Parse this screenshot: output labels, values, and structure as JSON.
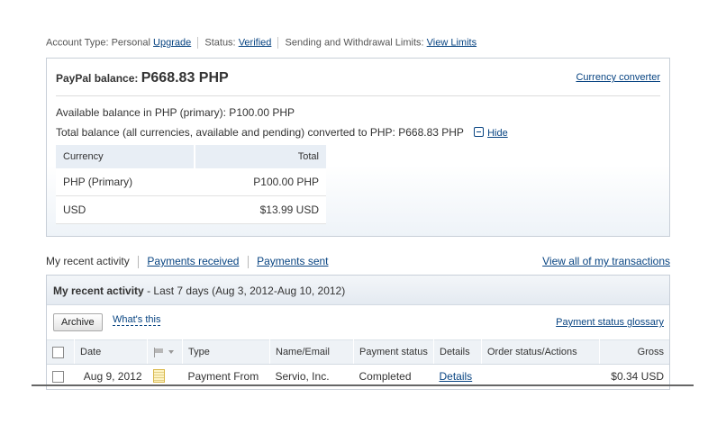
{
  "account_bar": {
    "account_type_label": "Account Type: Personal",
    "upgrade_link": "Upgrade",
    "status_label": "Status:",
    "status_link": "Verified",
    "limits_label": "Sending and Withdrawal Limits:",
    "limits_link": "View Limits"
  },
  "balance": {
    "label": "PayPal balance:",
    "amount": "P668.83 PHP",
    "converter_link": "Currency converter",
    "available_text": "Available balance in PHP (primary): P100.00 PHP",
    "total_text": "Total balance (all currencies, available and pending) converted to PHP: P668.83 PHP",
    "hide_link": "Hide",
    "table": {
      "headers": [
        "Currency",
        "Total"
      ],
      "rows": [
        {
          "currency": "PHP (Primary)",
          "total": "P100.00 PHP"
        },
        {
          "currency": "USD",
          "total": "$13.99 USD"
        }
      ]
    }
  },
  "activity_tabs": {
    "current": "My recent activity",
    "received": "Payments received",
    "sent": "Payments sent",
    "view_all": "View all of my transactions"
  },
  "activity": {
    "title": "My recent activity",
    "subtitle": "- Last 7 days (Aug 3, 2012-Aug 10, 2012)",
    "archive_button": "Archive",
    "whats_this": "What's this",
    "glossary_link": "Payment status glossary",
    "columns": {
      "date": "Date",
      "type": "Type",
      "name": "Name/Email",
      "status": "Payment status",
      "details": "Details",
      "order": "Order status/Actions",
      "gross": "Gross"
    },
    "rows": [
      {
        "date": "Aug 9, 2012",
        "type": "Payment From",
        "name": "Servio, Inc.",
        "status": "Completed",
        "details": "Details",
        "order": "",
        "gross": "$0.34 USD"
      }
    ]
  },
  "icons": {
    "hide": "minus-icon",
    "flag": "flag-icon",
    "note": "note-icon"
  },
  "colors": {
    "link": "#084482",
    "panel_border": "#c8cfd8",
    "header_bg": "#e8eef5"
  }
}
